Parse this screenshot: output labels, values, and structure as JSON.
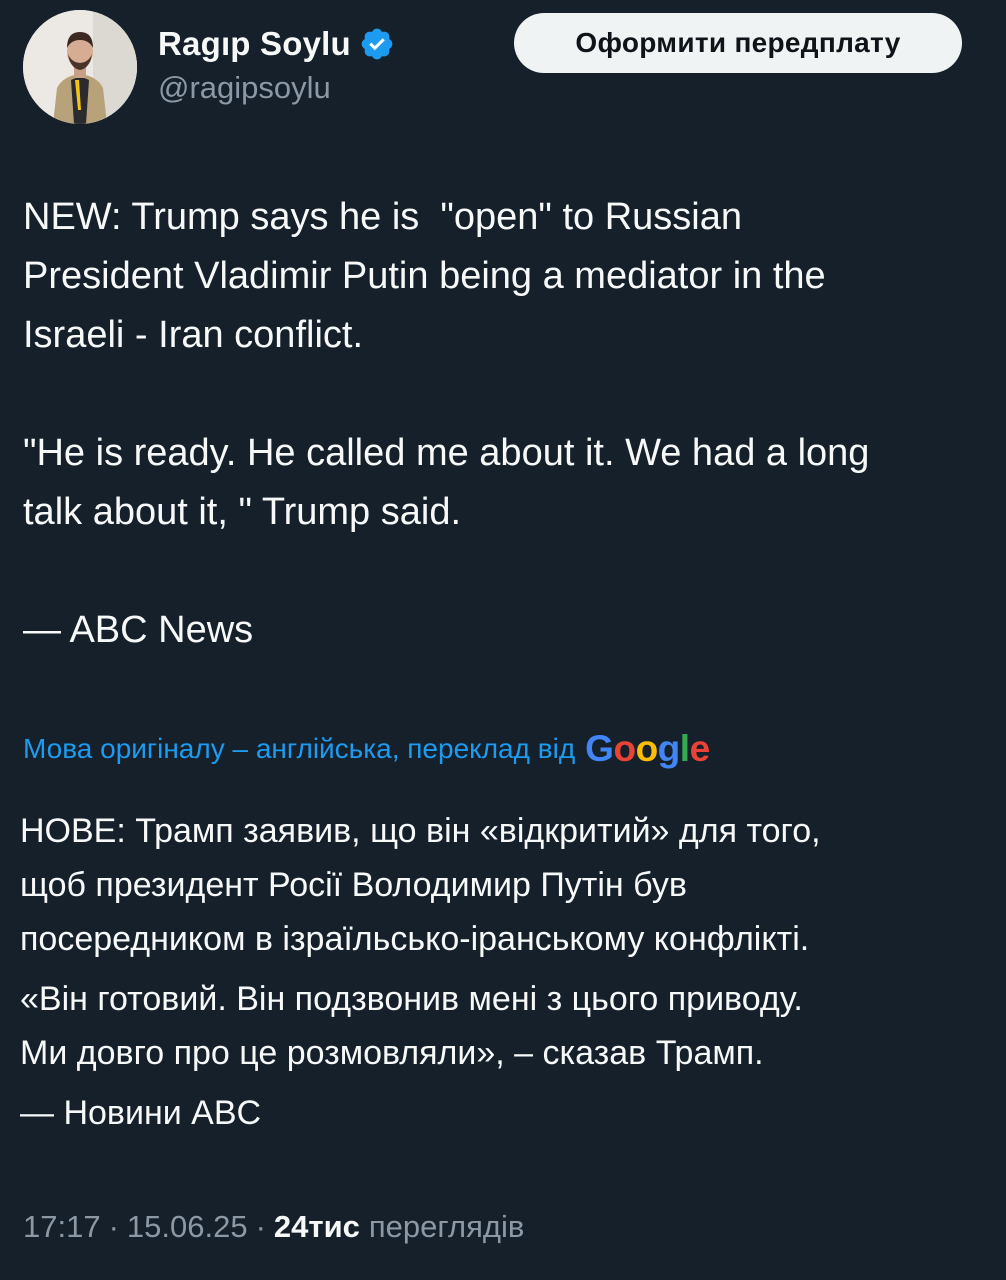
{
  "author": {
    "display_name": "Ragıp Soylu",
    "handle": "@ragipsoylu",
    "verified": true
  },
  "header": {
    "subscribe_label": "Оформити передплату"
  },
  "tweet": {
    "paragraphs": [
      "NEW: Trump says he is  \"open\" to Russian\nPresident Vladimir Putin being a mediator in the\nIsraeli - Iran conflict.",
      "\"He is ready. He called me about it. We had a long\ntalk about it, \" Trump said.",
      "— ABC News"
    ]
  },
  "translation": {
    "note": "Мова оригіналу – англійська, переклад від",
    "provider": "Google",
    "paragraphs": [
      "НОВЕ: Трамп заявив, що він «відкритий» для того,\nщоб президент Росії Володимир Путін був\nпосередником в ізраїльсько-іранському конфлікті.",
      "«Він готовий. Він подзвонив мені з цього приводу.\nМи довго про це розмовляли», – сказав Трамп.",
      "— Новини ABC"
    ]
  },
  "meta": {
    "time": "17:17",
    "separator": "·",
    "date": "15.06.25",
    "views_count": "24тис",
    "views_label": "переглядів"
  },
  "colors": {
    "background": "#15202b",
    "text_primary": "#f7f9f9",
    "text_secondary": "#8b98a5",
    "accent": "#1d9bf0",
    "button_bg": "#eff3f4"
  }
}
